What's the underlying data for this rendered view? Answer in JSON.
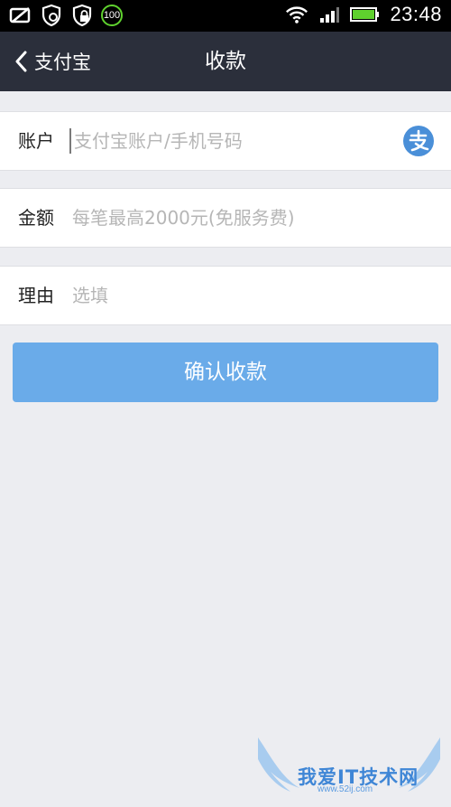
{
  "status_bar": {
    "battery_badge": "100",
    "time": "23:48"
  },
  "nav": {
    "back_label": "支付宝",
    "title": "收款"
  },
  "form": {
    "account": {
      "label": "账户",
      "placeholder": "支付宝账户/手机号码",
      "icon": "alipay-icon"
    },
    "amount": {
      "label": "金额",
      "placeholder": "每笔最高2000元(免服务费)"
    },
    "reason": {
      "label": "理由",
      "placeholder": "选填"
    }
  },
  "confirm_button": "确认收款",
  "watermark": {
    "title": "我爱IT技术网",
    "url": "www.52ij.com"
  },
  "colors": {
    "navbar": "#2b2f3b",
    "button": "#6aabe9",
    "background": "#ecedf1",
    "alipay_blue": "#4a8fd8",
    "battery_green": "#5fd12e"
  }
}
